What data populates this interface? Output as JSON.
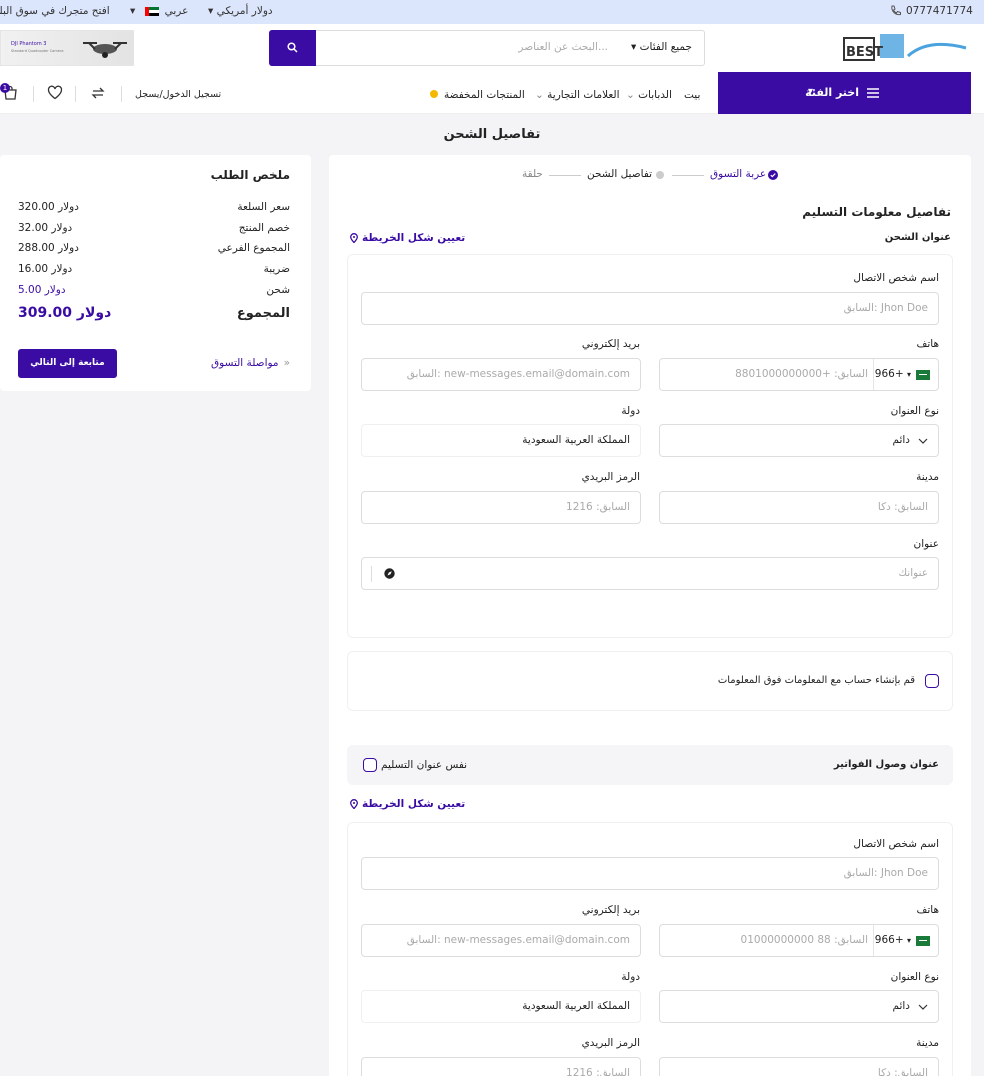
{
  "topbar": {
    "phone": "0777471774",
    "currency": "دولار أمريكي",
    "language": "عربي",
    "open_store": "افتح متجرك في سوق البلد"
  },
  "header": {
    "search_placeholder": "البحث عن العناصر...",
    "category_select": "جميع الفئات",
    "banner_title": "DJI Phantom 3",
    "banner_sub": "Standard Quadcopter Camera"
  },
  "nav": {
    "menu_label": "اختر الفئة",
    "items": [
      "بيت",
      "الدبابات",
      "العلامات التجارية",
      "المنتجات المخفضة"
    ],
    "login": "تسجيل الدخول/يسجل",
    "cart_count": "1"
  },
  "page": {
    "title": "تفاصيل الشحن"
  },
  "steps": [
    "عربة التسوق",
    "تفاصيل الشحن",
    "حلقة"
  ],
  "delivery": {
    "section_title": "تفاصيل معلومات التسليم",
    "shipping_address": "عنوان الشحن",
    "map_link": "تعيين شكل الخريطة",
    "contact_label": "اسم شخص الاتصال",
    "contact_ph": "السابق: Jhon Doe",
    "phone_label": "هاتف",
    "phone_code": "966+",
    "phone_ph": "السابق: +8801000000000",
    "email_label": "بريد إلكتروني",
    "email_ph": "السابق: new-messages.email@domain.com",
    "address_type_label": "نوع العنوان",
    "address_type_value": "دائم",
    "country_label": "دولة",
    "country_value": "المملكة العربية السعودية",
    "city_label": "مدينة",
    "city_ph": "السابق: دكا",
    "zip_label": "الرمز البريدي",
    "zip_ph": "السابق: 1216",
    "address_label": "عنوان",
    "address_ph": "عنوانك"
  },
  "create_account": "قم بإنشاء حساب مع المعلومات فوق المعلومات",
  "billing": {
    "title": "عنوان وصول الفواتير",
    "same_as": "نفس عنوان التسليم",
    "map_link": "تعيين شكل الخريطة",
    "contact_label": "اسم شخص الاتصال",
    "contact_ph": "السابق: Jhon Doe",
    "phone_label": "هاتف",
    "phone_code": "966+",
    "phone_ph": "السابق: 88 01000000000",
    "email_label": "بريد إلكتروني",
    "email_ph": "السابق: new-messages.email@domain.com",
    "address_type_label": "نوع العنوان",
    "address_type_value": "دائم",
    "country_label": "دولة",
    "country_value": "المملكة العربية السعودية",
    "city_label": "مدينة",
    "city_ph": "السابق: دكا",
    "zip_label": "الرمز البريدي",
    "zip_ph": "السابق: 1216"
  },
  "summary": {
    "title": "ملخص الطلب",
    "rows": [
      {
        "label": "سعر السلعة",
        "value": "320.00 دولار"
      },
      {
        "label": "خصم المنتج",
        "value": "32.00 دولار"
      },
      {
        "label": "المجموع الفرعي",
        "value": "288.00 دولار"
      },
      {
        "label": "ضريبة",
        "value": "16.00 دولار"
      },
      {
        "label": "شحن",
        "value": "5.00 دولار"
      }
    ],
    "total_label": "المجموع",
    "total_value": "309.00 دولار",
    "continue_shopping": "مواصلة التسوق",
    "proceed": "متابعة إلى التالي"
  },
  "colors": {
    "accent": "#3a0ca3",
    "topbar": "#dbe5fb"
  }
}
